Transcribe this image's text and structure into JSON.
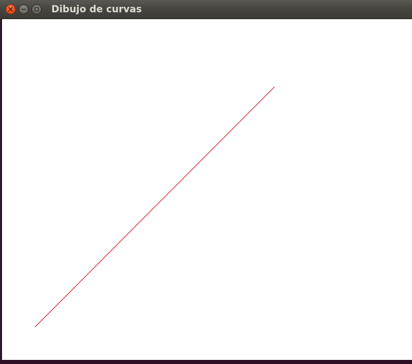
{
  "window": {
    "title": "Dibujo de curvas"
  },
  "titlebar_buttons": {
    "close": "close-icon",
    "minimize": "minimize-icon",
    "maximize": "maximize-icon"
  },
  "colors": {
    "curve": "#cc1f2e",
    "canvas_background": "#ffffff",
    "titlebar": "#3c3b37",
    "close_button": "#e95420"
  }
}
